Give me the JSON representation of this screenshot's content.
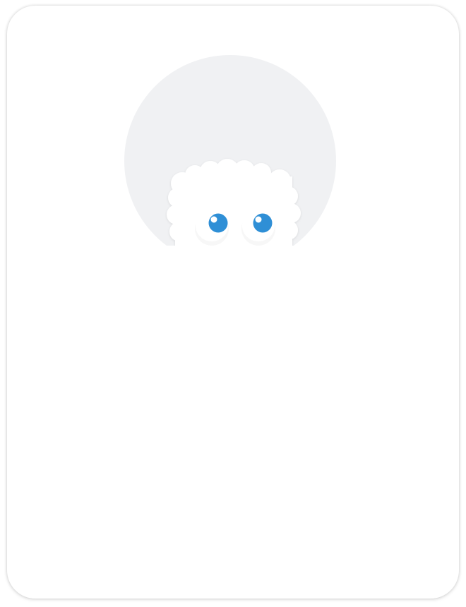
{
  "mascot": {
    "icon": "yeti-mascot-icon",
    "circle_color": "#f0f1f3",
    "fur_color": "#ffffff",
    "eye_color": "#2f8fd6"
  }
}
